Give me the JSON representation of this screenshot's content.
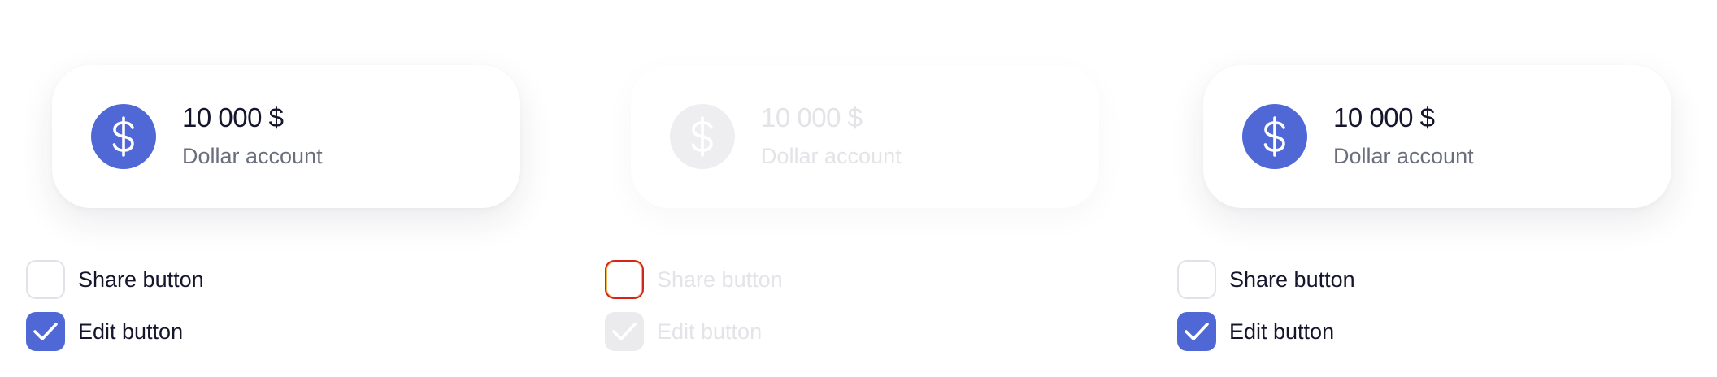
{
  "panels": [
    {
      "state": "default",
      "card": {
        "amount": "10 000 $",
        "label": "Dollar account",
        "icon": "dollar-icon"
      },
      "options": [
        {
          "label": "Share button",
          "checked": false
        },
        {
          "label": "Edit button",
          "checked": true
        }
      ]
    },
    {
      "state": "disabled",
      "card": {
        "amount": "10 000 $",
        "label": "Dollar account",
        "icon": "dollar-icon"
      },
      "options": [
        {
          "label": "Share button",
          "checked": false
        },
        {
          "label": "Edit button",
          "checked": true
        }
      ]
    },
    {
      "state": "default",
      "card": {
        "amount": "10 000 $",
        "label": "Dollar account",
        "icon": "dollar-icon"
      },
      "options": [
        {
          "label": "Share button",
          "checked": false
        },
        {
          "label": "Edit button",
          "checked": true
        }
      ]
    }
  ],
  "colors": {
    "accent": "#5068d6",
    "text_primary": "#15152b",
    "text_secondary": "#6b6e7d",
    "disabled": "#e3e3e8",
    "focus_ring": "#d4241c"
  }
}
